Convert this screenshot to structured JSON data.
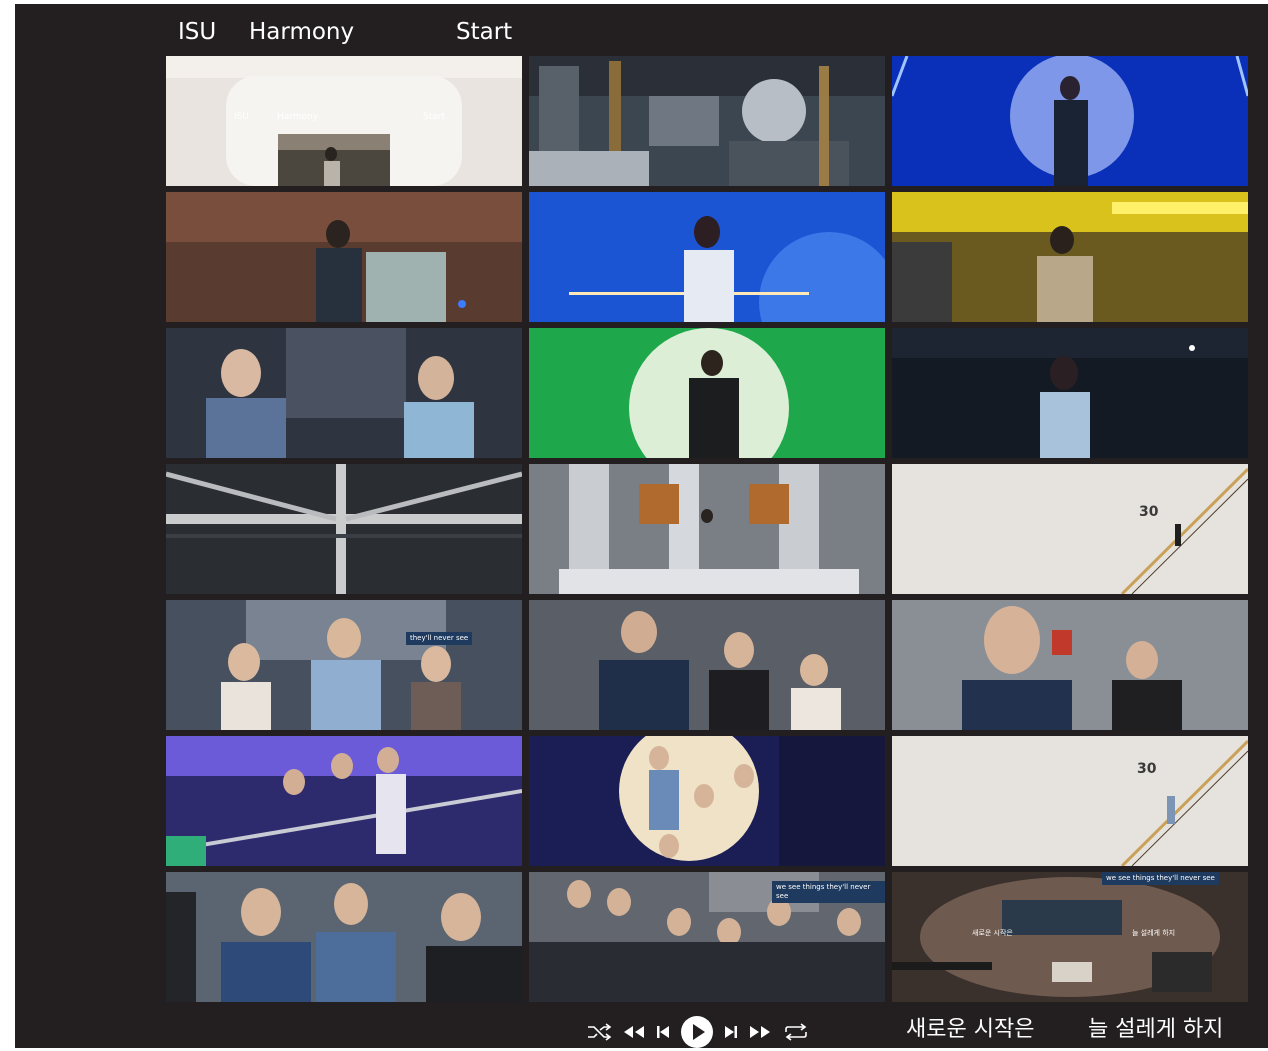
{
  "title": {
    "word1": "ISU",
    "word2": "Harmony",
    "word3": "Start"
  },
  "thumb_texts": {
    "isu": "ISU",
    "harmony": "Harmony",
    "start": "Start",
    "number_30_a": "30",
    "number_30_b": "30",
    "sign_a": "we see things they'll never see",
    "sign_b": "we see things they'll never see",
    "sign_c": "they'll never see",
    "stage_left": "새로운 시작은",
    "stage_right": "늘 설레게 하지"
  },
  "player": {
    "shuffle_icon": "shuffle-icon",
    "rewind_icon": "rewind-icon",
    "previous_icon": "skip-previous-icon",
    "play_icon": "play-circle-icon",
    "next_icon": "skip-next-icon",
    "forward_icon": "fast-forward-icon",
    "repeat_icon": "repeat-icon"
  },
  "lyrics": {
    "left": "새로운 시작은",
    "right": "늘 설레게 하지"
  },
  "colors": {
    "background": "#231f20",
    "text": "#ffffff"
  }
}
